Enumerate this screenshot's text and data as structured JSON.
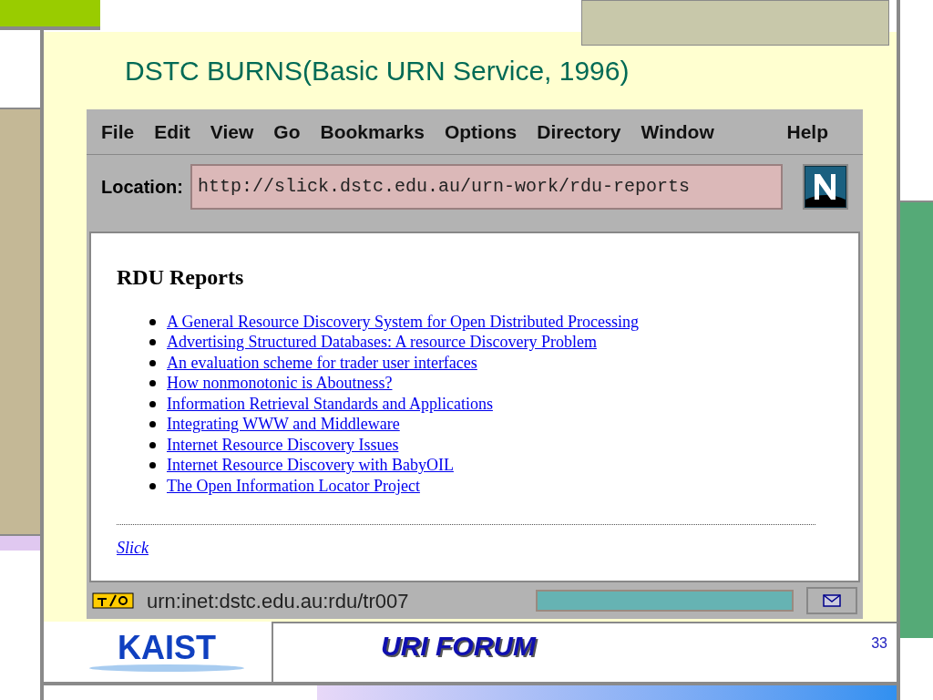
{
  "slide": {
    "title": "DSTC BURNS(Basic URN Service, 1996)",
    "page_number": "33"
  },
  "browser": {
    "menu": [
      "File",
      "Edit",
      "View",
      "Go",
      "Bookmarks",
      "Options",
      "Directory",
      "Window",
      "Help"
    ],
    "location_label": "Location:",
    "url": "http://slick.dstc.edu.au/urn-work/rdu-reports",
    "page": {
      "heading": "RDU Reports",
      "links": [
        "A General Resource Discovery System for Open Distributed Processing",
        "Advertising Structured Databases: A resource Discovery Problem",
        "An evaluation scheme for trader user interfaces",
        "How nonmonotonic is Aboutness?",
        "Information Retrieval Standards and Applications",
        "Integrating WWW and Middleware",
        "Internet Resource Discovery Issues",
        "Internet Resource Discovery with BabyOIL",
        "The Open Information Locator Project"
      ],
      "footer_link": "Slick"
    },
    "status": {
      "text": "urn:inet:dstc.edu.au:rdu/tr007",
      "level": 1
    }
  },
  "footer": {
    "logo": "KAIST",
    "forum": "URI FORUM"
  }
}
